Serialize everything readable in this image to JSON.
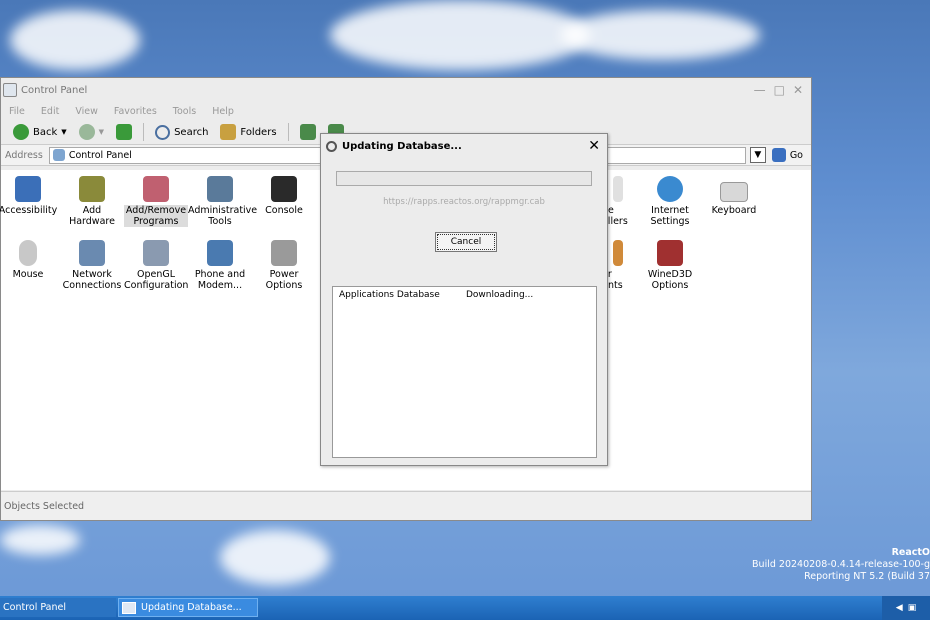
{
  "window": {
    "title": "Control Panel",
    "menu": [
      "File",
      "Edit",
      "View",
      "Favorites",
      "Tools",
      "Help"
    ],
    "toolbar": {
      "back": "Back",
      "search": "Search",
      "folders": "Folders"
    },
    "address": {
      "label": "Address",
      "value": "Control Panel",
      "go": "Go"
    },
    "items_row1": [
      {
        "line1": "Accessibility",
        "line2": ""
      },
      {
        "line1": "Add",
        "line2": "Hardware"
      },
      {
        "line1": "Add/Remove",
        "line2": "Programs"
      },
      {
        "line1": "Administrative",
        "line2": "Tools"
      },
      {
        "line1": "Console",
        "line2": ""
      },
      {
        "line1": "ne",
        "line2": "ollers"
      },
      {
        "line1": "Internet",
        "line2": "Settings"
      },
      {
        "line1": "Keyboard",
        "line2": ""
      }
    ],
    "items_row2": [
      {
        "line1": "Mouse",
        "line2": ""
      },
      {
        "line1": "Network",
        "line2": "Connections"
      },
      {
        "line1": "OpenGL",
        "line2": "Configuration"
      },
      {
        "line1": "Phone and",
        "line2": "Modem..."
      },
      {
        "line1": "Power",
        "line2": "Options"
      },
      {
        "line1": "er",
        "line2": "unts"
      },
      {
        "line1": "WineD3D",
        "line2": "Options"
      }
    ],
    "status": "Objects Selected"
  },
  "dialog": {
    "title": "Updating Database...",
    "progress": 0,
    "url": "https://rapps.reactos.org/rappmgr.cab",
    "cancel": "Cancel",
    "list": [
      {
        "name": "Applications Database",
        "status": "Downloading..."
      }
    ]
  },
  "taskbar": {
    "tasks": [
      "Control Panel",
      "Updating Database..."
    ]
  },
  "watermark": {
    "line1": "ReactO",
    "line2": "Build 20240208-0.4.14-release-100-g",
    "line3": "Reporting NT 5.2 (Build 37"
  },
  "colors": {
    "taskbar": "#1b63b4",
    "window_bg": "#ececec",
    "progress": "#6aa84f"
  }
}
